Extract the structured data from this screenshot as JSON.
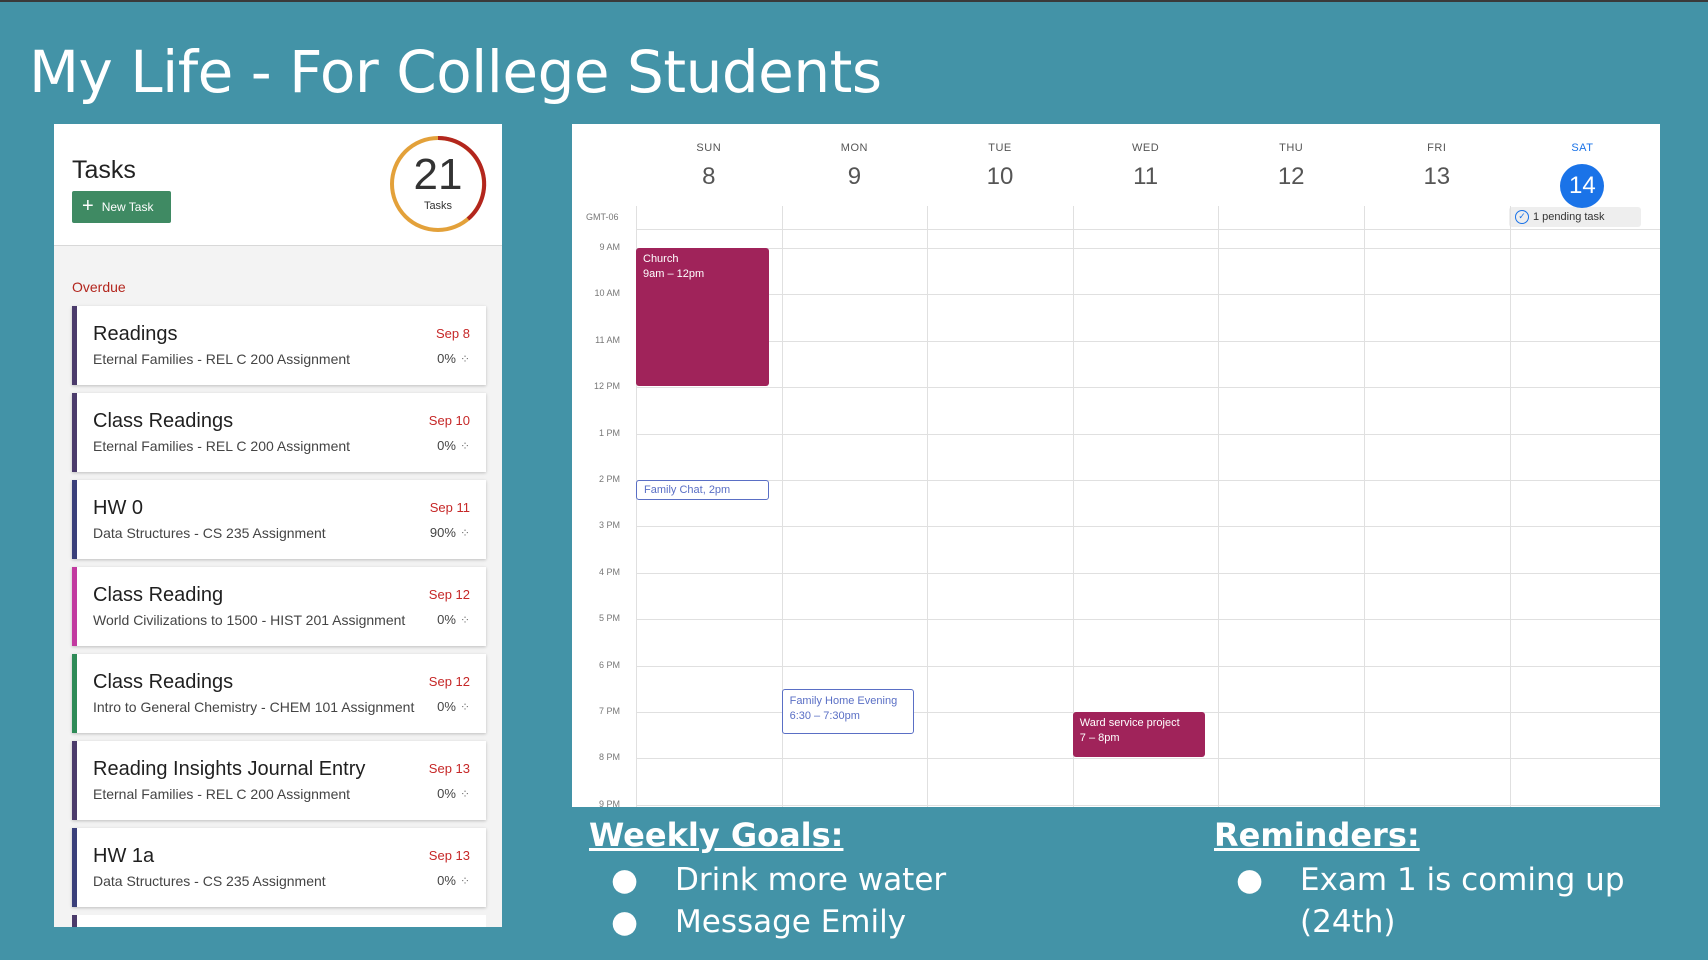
{
  "slide": {
    "title": "My Life - For College Students"
  },
  "tasks": {
    "title": "Tasks",
    "new_task_label": "New Task",
    "count": "21",
    "count_label": "Tasks",
    "overdue_label": "Overdue",
    "items": [
      {
        "name": "Readings",
        "course": "Eternal Families - REL C 200 Assignment",
        "due": "Sep 8",
        "progress": "0%",
        "color": "#4b3b6b"
      },
      {
        "name": "Class Readings",
        "course": "Eternal Families - REL C 200 Assignment",
        "due": "Sep 10",
        "progress": "0%",
        "color": "#4b3b6b"
      },
      {
        "name": "HW 0",
        "course": "Data Structures - CS 235 Assignment",
        "due": "Sep 11",
        "progress": "90%",
        "color": "#3a3f7a"
      },
      {
        "name": "Class Reading",
        "course": "World Civilizations to 1500 - HIST 201 Assignment",
        "due": "Sep 12",
        "progress": "0%",
        "color": "#c23aa0"
      },
      {
        "name": "Class Readings",
        "course": "Intro to General Chemistry - CHEM 101 Assignment",
        "due": "Sep 12",
        "progress": "0%",
        "color": "#2e8b57"
      },
      {
        "name": "Reading Insights Journal Entry",
        "course": "Eternal Families - REL C 200 Assignment",
        "due": "Sep 13",
        "progress": "0%",
        "color": "#4b3b6b"
      },
      {
        "name": "HW 1a",
        "course": "Data Structures - CS 235 Assignment",
        "due": "Sep 13",
        "progress": "0%",
        "color": "#3a3f7a"
      }
    ]
  },
  "calendar": {
    "timezone": "GMT-06",
    "days": [
      {
        "name": "SUN",
        "num": "8"
      },
      {
        "name": "MON",
        "num": "9"
      },
      {
        "name": "TUE",
        "num": "10"
      },
      {
        "name": "WED",
        "num": "11"
      },
      {
        "name": "THU",
        "num": "12"
      },
      {
        "name": "FRI",
        "num": "13"
      },
      {
        "name": "SAT",
        "num": "14",
        "today": true
      }
    ],
    "hours": [
      "9 AM",
      "10 AM",
      "11 AM",
      "12 PM",
      "1 PM",
      "2 PM",
      "3 PM",
      "4 PM",
      "5 PM",
      "6 PM",
      "7 PM",
      "8 PM",
      "9 PM"
    ],
    "pending_task": "1 pending task",
    "events": [
      {
        "title": "Church",
        "time": "9am – 12pm",
        "style": "filled"
      },
      {
        "title": "Family Chat",
        "time": "2pm",
        "style": "outline"
      },
      {
        "title": "Family Home Evening",
        "time": "6:30 – 7:30pm",
        "style": "outline"
      },
      {
        "title": "Ward service project",
        "time": "7 – 8pm",
        "style": "filled"
      }
    ]
  },
  "weekly_goals": {
    "heading": "Weekly Goals:",
    "items": [
      "Drink more water",
      "Message Emily"
    ]
  },
  "reminders": {
    "heading": "Reminders:",
    "items": [
      "Exam 1 is coming up",
      "(24th)"
    ]
  }
}
